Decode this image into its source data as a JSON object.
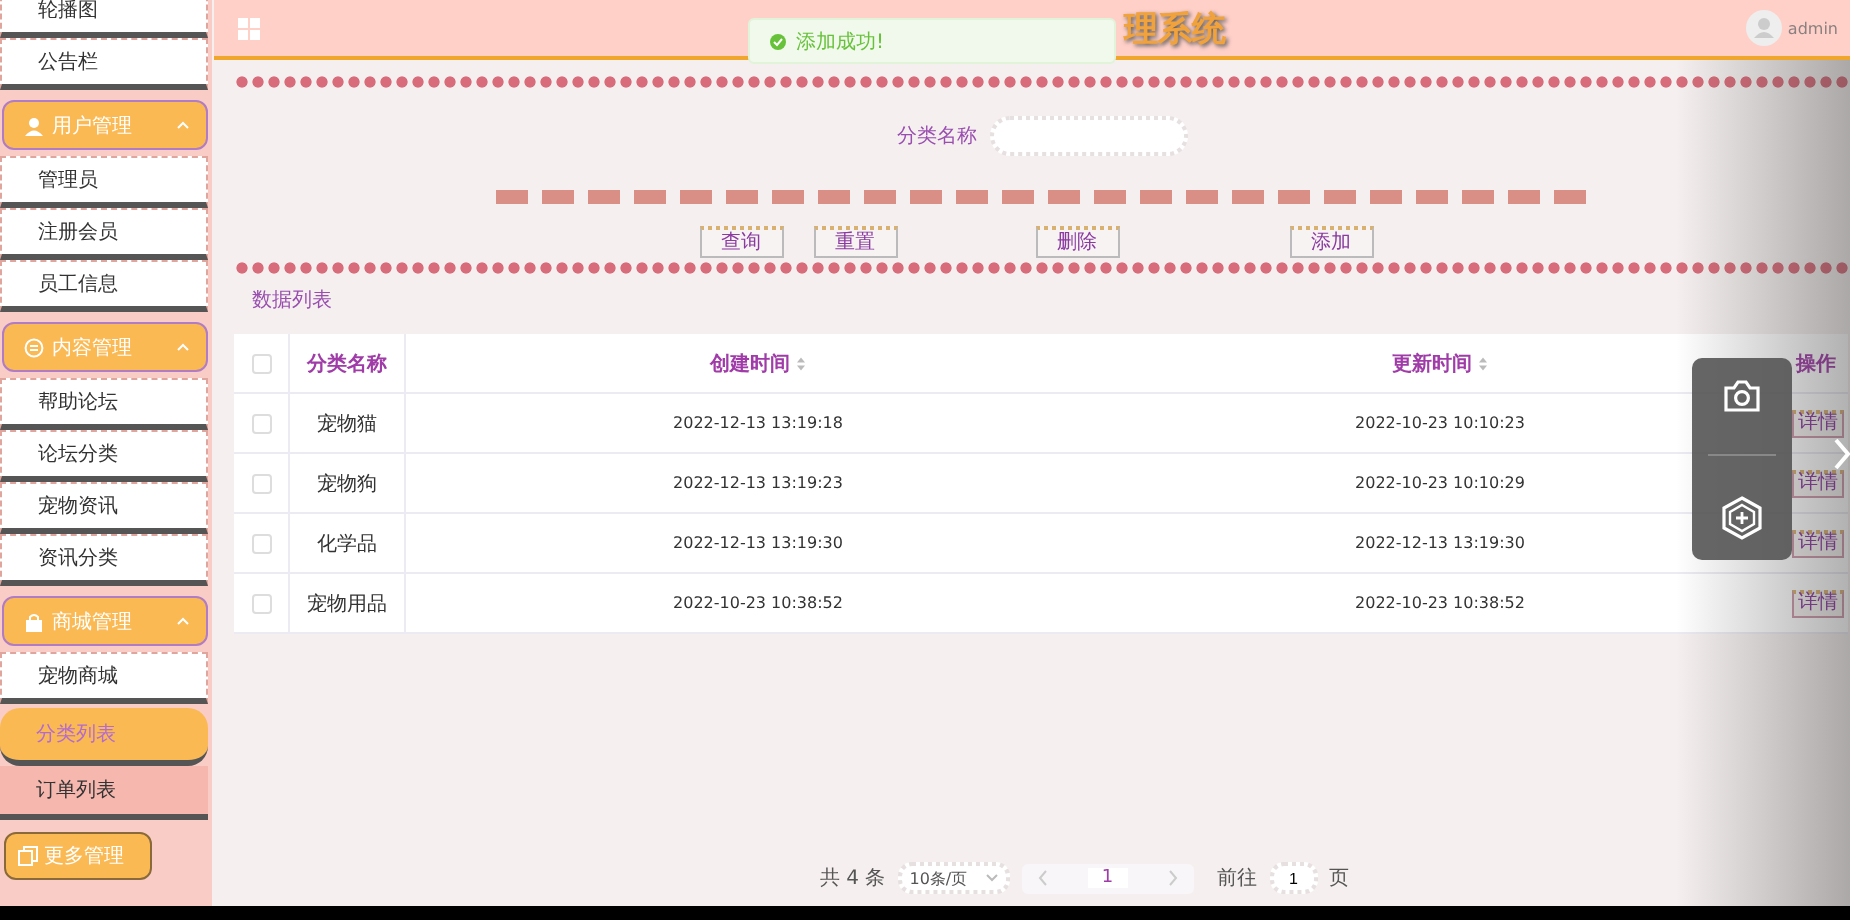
{
  "header": {
    "title": "理系统",
    "user": "admin"
  },
  "toast": {
    "message": "添加成功!"
  },
  "sidebar": {
    "items": [
      {
        "kind": "item",
        "label": "轮播图",
        "selected": false,
        "hovered": false
      },
      {
        "kind": "item",
        "label": "公告栏",
        "selected": false,
        "hovered": false
      },
      {
        "kind": "group",
        "label": "用户管理",
        "expanded": true,
        "children": [
          {
            "kind": "item",
            "label": "管理员",
            "selected": false,
            "hovered": false
          },
          {
            "kind": "item",
            "label": "注册会员",
            "selected": false,
            "hovered": false
          },
          {
            "kind": "item",
            "label": "员工信息",
            "selected": false,
            "hovered": false
          }
        ]
      },
      {
        "kind": "group",
        "label": "内容管理",
        "expanded": true,
        "children": [
          {
            "kind": "item",
            "label": "帮助论坛",
            "selected": false,
            "hovered": false
          },
          {
            "kind": "item",
            "label": "论坛分类",
            "selected": false,
            "hovered": false
          },
          {
            "kind": "item",
            "label": "宠物资讯",
            "selected": false,
            "hovered": false
          },
          {
            "kind": "item",
            "label": "资讯分类",
            "selected": false,
            "hovered": false
          }
        ]
      },
      {
        "kind": "group",
        "label": "商城管理",
        "expanded": true,
        "children": [
          {
            "kind": "item",
            "label": "宠物商城",
            "selected": false,
            "hovered": false
          },
          {
            "kind": "item",
            "label": "分类列表",
            "selected": true,
            "hovered": false
          },
          {
            "kind": "item",
            "label": "订单列表",
            "selected": false,
            "hovered": true
          }
        ]
      }
    ],
    "more_button": "更多管理"
  },
  "search": {
    "label": "分类名称",
    "buttons": [
      "查询",
      "重置",
      "删除",
      "添加"
    ]
  },
  "data_list_link": "数据列表",
  "table": {
    "header_checkbox": {
      "checked": false
    },
    "columns": [
      {
        "label": "分类名称",
        "sortable": false
      },
      {
        "label": "创建时间",
        "sortable": true
      },
      {
        "label": "更新时间",
        "sortable": true
      },
      {
        "label": "操作",
        "sortable": false
      }
    ],
    "rows": [
      {
        "checked": false,
        "cells": [
          "宠物猫",
          "2022-12-13 13:19:18",
          "2022-10-23 10:10:23"
        ],
        "action": "详情"
      },
      {
        "checked": false,
        "cells": [
          "宠物狗",
          "2022-12-13 13:19:23",
          "2022-10-23 10:10:29"
        ],
        "action": "详情"
      },
      {
        "checked": false,
        "cells": [
          "化学品",
          "2022-12-13 13:19:30",
          "2022-12-13 13:19:30"
        ],
        "action": "详情"
      },
      {
        "checked": false,
        "cells": [
          "宠物用品",
          "2022-10-23 10:38:52",
          "2022-10-23 10:38:52"
        ],
        "action": "详情"
      }
    ]
  },
  "pagination": {
    "total": "共 4 条",
    "page_size": "10条/页",
    "pages": [
      {
        "label": "1",
        "selected": true
      }
    ],
    "goto_label": "前往",
    "goto_value": "1",
    "page_suffix": "页"
  }
}
